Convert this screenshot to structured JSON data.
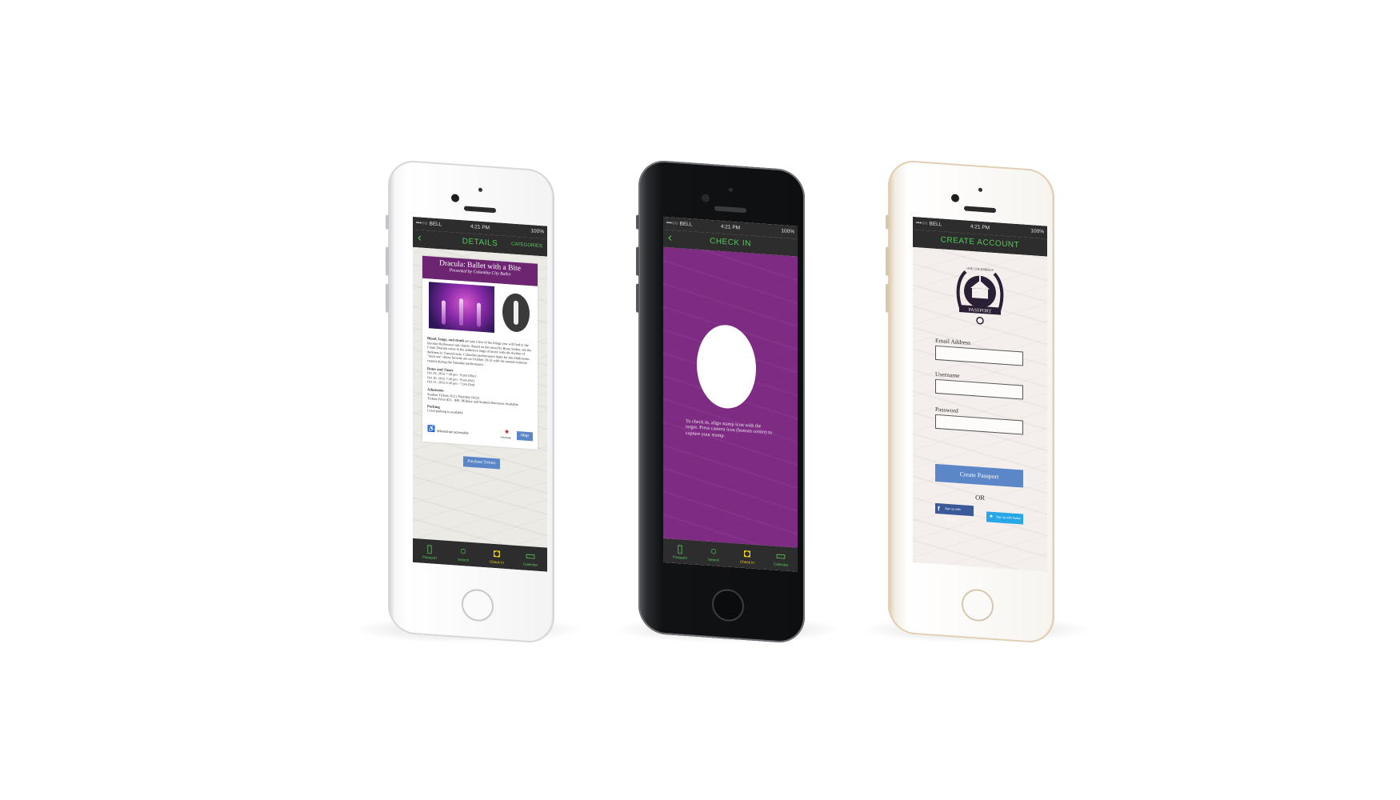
{
  "status_bar": {
    "carrier": "•••○○ BELL",
    "time": "4:21 PM",
    "battery": "100%"
  },
  "tab_bar": {
    "items": [
      {
        "label": "Passport",
        "icon": "book-icon"
      },
      {
        "label": "Search",
        "icon": "search-icon"
      },
      {
        "label": "Check In",
        "icon": "camera-icon"
      },
      {
        "label": "Calendar",
        "icon": "calendar-icon"
      }
    ],
    "active_index": 2
  },
  "details_screen": {
    "nav_title": "DETAILS",
    "nav_right": "CATEGORIES",
    "event_title": "Dracula: Ballet with a Bite",
    "event_subtitle": "Presented by Columbia City Ballet",
    "description_lead": "Blood, fangs, and death",
    "description": "are just a few of the things you will find in the favorite Halloween cult classic. Based on the novel by Bram Stoker, see the Count Dracula come to the seductive reign of terror with the rhythm of darkness in Transylvania. Columbia performance dates for this Halloween \"must see\" dance favorite are on October 29-31 with the annual costume contest during the Saturday performance.",
    "dates_heading": "Dates and Times",
    "dates": [
      "Oct 29, 2015 7:30 pm - 9 pm (Thu)",
      "Oct 30, 2015 7:30 pm - 9 pm (Fri)",
      "Oct 31, 2015 6:30 pm - 7 pm (Sat)"
    ],
    "admission_heading": "Admission",
    "admission": [
      "Student Tickets: $12 (Thursday Only)",
      "Tickets From $23 - $45. Military and Student Discounts Available"
    ],
    "parking_heading": "Parking",
    "parking": "Local parking is available",
    "accessibility": "Wheelchair accessible",
    "favorite_label": "Favorite",
    "map_button": "Map",
    "purchase_button": "Purchase Tickets"
  },
  "checkin_screen": {
    "nav_title": "CHECK IN",
    "instructions": "To check in, align stamp icon with the target. Press camera icon (bottom center) to capture your stamp."
  },
  "account_screen": {
    "nav_title": "CREATE ACCOUNT",
    "badge_top_text": "ONE COLUMBIA'S",
    "badge_ribbon_text": "PASSPORT",
    "fields": [
      {
        "label": "Email Address",
        "value": ""
      },
      {
        "label": "Username",
        "value": ""
      },
      {
        "label": "Password",
        "value": ""
      }
    ],
    "create_button": "Create Passport",
    "or_text": "OR",
    "facebook_button": "Sign up with Facebook",
    "twitter_button": "Sign up with Twitter"
  },
  "colors": {
    "nav_bg": "#2d2d2d",
    "nav_text": "#59c95c",
    "tab_active": "#f4d21b",
    "purple": "#7e2c83",
    "button_blue": "#5b87c8",
    "facebook": "#3b5998",
    "twitter": "#28a7e8"
  }
}
